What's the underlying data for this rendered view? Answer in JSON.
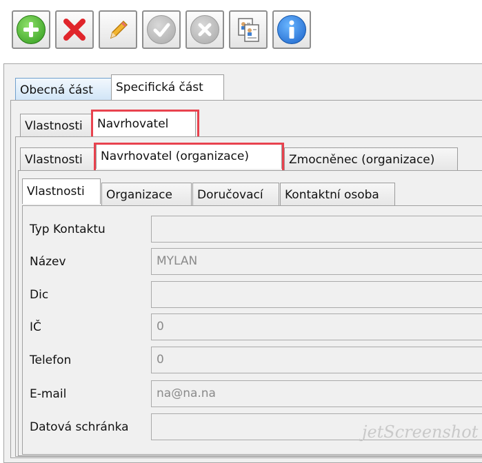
{
  "toolbar": {
    "buttons": [
      {
        "name": "add-icon",
        "enabled": true
      },
      {
        "name": "delete-icon",
        "enabled": true
      },
      {
        "name": "edit-icon",
        "enabled": true
      },
      {
        "name": "confirm-icon",
        "enabled": false
      },
      {
        "name": "cancel-icon",
        "enabled": false
      },
      {
        "name": "copy-contacts-icon",
        "enabled": true
      },
      {
        "name": "info-icon",
        "enabled": true
      }
    ]
  },
  "tabs_level1": [
    "Obecná část",
    "Specifická část"
  ],
  "tabs_level2": [
    "Vlastnosti",
    "Navrhovatel"
  ],
  "tabs_level3": [
    "Vlastnosti",
    "Navrhovatel (organizace)",
    "Zmocněnec (organizace)"
  ],
  "tabs_level4": [
    "Vlastnosti",
    "Organizace",
    "Doručovací",
    "Kontaktní osoba"
  ],
  "fields": [
    {
      "label": "Typ Kontaktu",
      "value": ""
    },
    {
      "label": "Název",
      "value": "MYLAN"
    },
    {
      "label": "Dic",
      "value": ""
    },
    {
      "label": "IČ",
      "value": "0"
    },
    {
      "label": "Telefon",
      "value": "0"
    },
    {
      "label": "E-mail",
      "value": "na@na.na"
    },
    {
      "label": "Datová schránka",
      "value": ""
    }
  ],
  "watermark": "jetScreenshot",
  "colors": {
    "highlight_red": "#e8424e",
    "add_green": "#2f9a1c",
    "delete_red": "#e0252b",
    "info_blue": "#1b62c9",
    "disabled_gray": "#a9a9a9"
  }
}
